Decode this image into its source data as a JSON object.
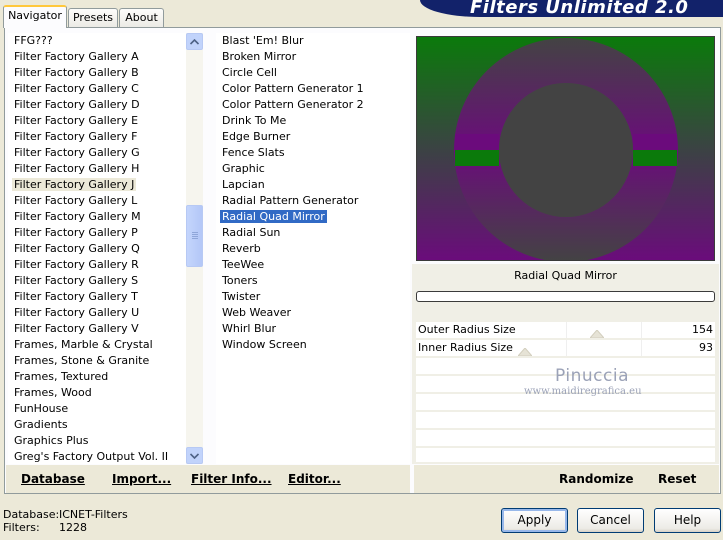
{
  "tabs": [
    {
      "label": "Navigator",
      "active": true
    },
    {
      "label": "Presets",
      "active": false
    },
    {
      "label": "About",
      "active": false
    }
  ],
  "app_title": "Filters Unlimited 2.0",
  "categories": [
    {
      "label": "FFG???",
      "selected": false
    },
    {
      "label": "Filter Factory Gallery A",
      "selected": false
    },
    {
      "label": "Filter Factory Gallery B",
      "selected": false
    },
    {
      "label": "Filter Factory Gallery C",
      "selected": false
    },
    {
      "label": "Filter Factory Gallery D",
      "selected": false
    },
    {
      "label": "Filter Factory Gallery E",
      "selected": false
    },
    {
      "label": "Filter Factory Gallery F",
      "selected": false
    },
    {
      "label": "Filter Factory Gallery G",
      "selected": false
    },
    {
      "label": "Filter Factory Gallery H",
      "selected": false
    },
    {
      "label": "Filter Factory Gallery J",
      "selected": true
    },
    {
      "label": "Filter Factory Gallery L",
      "selected": false
    },
    {
      "label": "Filter Factory Gallery M",
      "selected": false
    },
    {
      "label": "Filter Factory Gallery P",
      "selected": false
    },
    {
      "label": "Filter Factory Gallery Q",
      "selected": false
    },
    {
      "label": "Filter Factory Gallery R",
      "selected": false
    },
    {
      "label": "Filter Factory Gallery S",
      "selected": false
    },
    {
      "label": "Filter Factory Gallery T",
      "selected": false
    },
    {
      "label": "Filter Factory Gallery U",
      "selected": false
    },
    {
      "label": "Filter Factory Gallery V",
      "selected": false
    },
    {
      "label": "Frames, Marble & Crystal",
      "selected": false
    },
    {
      "label": "Frames, Stone & Granite",
      "selected": false
    },
    {
      "label": "Frames, Textured",
      "selected": false
    },
    {
      "label": "Frames, Wood",
      "selected": false
    },
    {
      "label": "FunHouse",
      "selected": false
    },
    {
      "label": "Gradients",
      "selected": false
    },
    {
      "label": "Graphics Plus",
      "selected": false
    },
    {
      "label": "Greg's Factory Output Vol. II",
      "selected": false
    }
  ],
  "filters": [
    {
      "label": "Blast 'Em! Blur",
      "selected": false
    },
    {
      "label": "Broken Mirror",
      "selected": false
    },
    {
      "label": "Circle Cell",
      "selected": false
    },
    {
      "label": "Color Pattern Generator 1",
      "selected": false
    },
    {
      "label": "Color Pattern Generator 2",
      "selected": false
    },
    {
      "label": "Drink To Me",
      "selected": false
    },
    {
      "label": "Edge Burner",
      "selected": false
    },
    {
      "label": "Fence Slats",
      "selected": false
    },
    {
      "label": "Graphic",
      "selected": false
    },
    {
      "label": "Lapcian",
      "selected": false
    },
    {
      "label": "Radial Pattern Generator",
      "selected": false
    },
    {
      "label": "Radial Quad Mirror",
      "selected": true
    },
    {
      "label": "Radial Sun",
      "selected": false
    },
    {
      "label": "Reverb",
      "selected": false
    },
    {
      "label": "TeeWee",
      "selected": false
    },
    {
      "label": "Toners",
      "selected": false
    },
    {
      "label": "Twister",
      "selected": false
    },
    {
      "label": "Web Weaver",
      "selected": false
    },
    {
      "label": "Whirl Blur",
      "selected": false
    },
    {
      "label": "Window Screen",
      "selected": false
    }
  ],
  "scroll_up_icon": "arrow-up-icon",
  "scroll_down_icon": "arrow-down-icon",
  "left_toolbar": {
    "database": "Database",
    "import": "Import...",
    "filter_info": "Filter Info...",
    "editor": "Editor..."
  },
  "preview": {
    "filter_name": "Radial Quad Mirror",
    "colors": {
      "green": "#0b7a0b",
      "purple": "#6b0b7c",
      "gray": "#434343"
    }
  },
  "params": [
    {
      "label": "Outer Radius Size",
      "value": "154",
      "level": 154
    },
    {
      "label": "Inner Radius Size",
      "value": "93",
      "level": 93
    }
  ],
  "watermark": {
    "line1": "Pinuccia",
    "line2": "www.maidiregrafica.eu"
  },
  "right_toolbar": {
    "randomize": "Randomize",
    "reset": "Reset"
  },
  "footer": {
    "database_label": "Database:",
    "database_value": "ICNET-Filters",
    "filters_label": "Filters:",
    "filters_value": "1228"
  },
  "buttons": {
    "apply": "Apply",
    "cancel": "Cancel",
    "help": "Help"
  }
}
